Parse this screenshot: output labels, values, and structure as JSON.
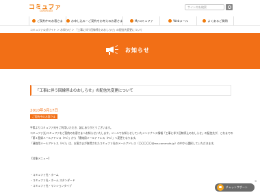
{
  "header": {
    "logo": "コミュファ",
    "logo_sub": "commufa",
    "search_placeholder": "サイト内を検索"
  },
  "nav": {
    "items": [
      {
        "label": "ご契約中のお客さま"
      },
      {
        "label": "お申し込み・ご契約をお考えのお客さま"
      },
      {
        "label": "Myコミュファ"
      },
      {
        "label": "Webメール"
      },
      {
        "label": "よくあるご質問"
      }
    ]
  },
  "breadcrumb": "コミュファ公式サイト ＞ お知らせ ＞ 「工事に伴う回線停止のおしらせ」の配信先変更について",
  "banner": {
    "title": "お知らせ"
  },
  "article": {
    "title": "「工事に伴う回線停止のおしらせ」の配信先変更について",
    "date": "2010年3月17日",
    "tag": "ご契約中のお客さま",
    "paragraphs": [
      "平素よりコミュファ光をご利用いただき、誠にありがとうございます。",
      "コミュファ光/コミュファをご契約のお客さまへお知らせいたします。メールでお知らせしていたメンテナンス情報「工事に伴う回線停止のおしらせ」の配信先が、これまでの「第１登録メールアドレス（PC）」から「連絡用メールアドレス（PC）」へ変更となります。",
      "「連絡用メールアドレス（PC）」は、お客さまが取得されたコミュファ光のメールアドレス（〇〇〇〇〇@ma.commufa.jp）の中から選択していただきます。"
    ],
    "list_title": "【対象メニュー】",
    "list_items": [
      "・コミュファ光・ホーム",
      "・コミュファ光・ホーム スタンダード",
      "・コミュファ光・マンションタイプ"
    ]
  },
  "chat": {
    "label": "チャットサポート",
    "close": "×"
  }
}
